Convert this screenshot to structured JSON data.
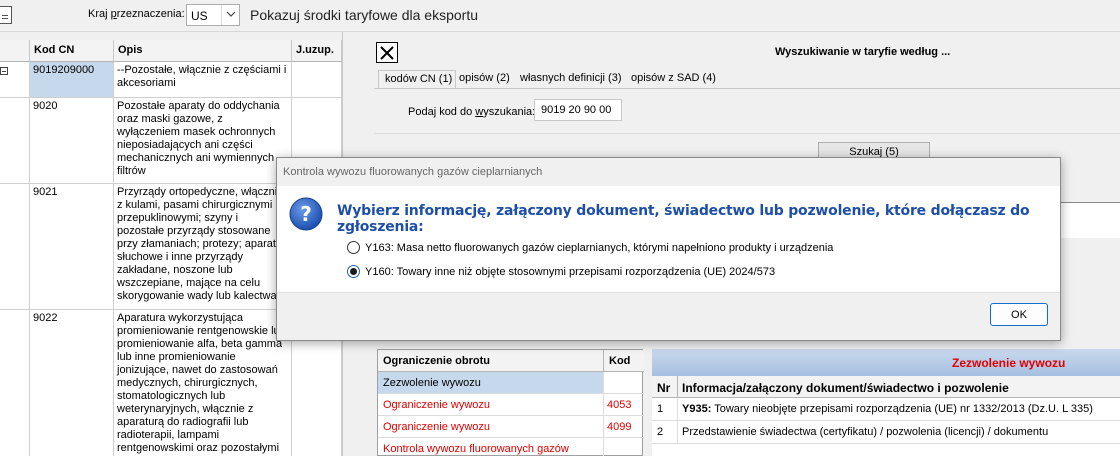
{
  "toolbar": {
    "doc_icon": "document-icon",
    "country_label_prefix": "Kraj ",
    "country_label_underlined": "p",
    "country_label_suffix": "rzeznaczenia:",
    "country_value": "US",
    "export_label": "Pokazuj środki taryfowe dla eksportu"
  },
  "left_table": {
    "headers": [
      "Kod CN",
      "Opis",
      "J.uzup."
    ],
    "rows": [
      {
        "code": "9019209000",
        "desc": "--Pozostałe, włącznie z częściami i akcesoriami",
        "unit": ""
      },
      {
        "code": "9020",
        "desc": "Pozostałe aparaty do oddychania oraz maski gazowe, z wyłączeniem masek ochronnych nieposiadających ani części mechanicznych ani wymiennych filtrów",
        "unit": ""
      },
      {
        "code": "9021",
        "desc": "Przyrządy ortopedyczne, włącznie z kulami, pasami chirurgicznymi i przepuklinowymi; szyny i pozostałe przyrządy stosowane przy złamaniach; protezy; aparaty słuchowe i inne przyrządy zakładane, noszone lub wszczepiane, mające na celu skorygowanie wady lub kalectwa",
        "unit": ""
      },
      {
        "code": "9022",
        "desc": "Aparatura wykorzystująca promieniowanie rentgenowskie lub promieniowanie alfa, beta gamma lub inne promieniowanie jonizujące, nawet do zastosowań medycznych, chirurgicznych, stomatologicznych lub weterynaryjnych, włącznie z aparaturą do radiografii lub radioterapii, lampami rentgenowskimi oraz pozostałymi generatorami promieni rentgena,",
        "unit": ""
      }
    ]
  },
  "search_panel": {
    "title": "Wyszukiwanie w taryfie według ...",
    "tabs": [
      "kodów CN (1)",
      "opisów (2)",
      "własnych definicji (3)",
      "opisów z SAD (4)"
    ],
    "code_label_prefix": "Podaj kod do ",
    "code_label_underlined": "w",
    "code_label_suffix": "yszukania:",
    "code_value": "9019 20 90 00",
    "search_button": "Szukaj (5)"
  },
  "restriction_table": {
    "headers": [
      "Ograniczenie obrotu",
      "Kod"
    ],
    "rows": [
      {
        "name": "Zezwolenie wywozu",
        "code": "",
        "red": false,
        "selected": true
      },
      {
        "name": "Ograniczenie wywozu",
        "code": "4053",
        "red": true,
        "selected": false
      },
      {
        "name": "Ograniczenie wywozu",
        "code": "4099",
        "red": true,
        "selected": false
      },
      {
        "name": "Kontrola wywozu fluorowanych gazów",
        "code": "",
        "red": true,
        "selected": false
      }
    ]
  },
  "permit_panel": {
    "title": "Zezwolenie wywozu",
    "headers": [
      "Nr",
      "Informacja/załączony dokument/świadectwo i pozwolenie"
    ],
    "rows": [
      {
        "nr": "1",
        "code": "Y935:",
        "text": " Towary nieobjęte przepisami rozporządzenia (UE) nr 1332/2013 (Dz.U. L 335)"
      },
      {
        "nr": "2",
        "code": "",
        "text": "Przedstawienie świadectwa (certyfikatu) / pozwolenia (licencji) / dokumentu"
      }
    ]
  },
  "dialog": {
    "title": "Kontrola wywozu fluorowanych gazów cieplarnianych",
    "icon": "question-icon",
    "heading": "Wybierz informację, załączony dokument, świadectwo lub pozwolenie, które dołączasz do zgłoszenia:",
    "options": [
      {
        "label": "Y163: Masa netto fluorowanych gazów cieplarnianych, którymi napełniono produkty i urządzenia",
        "checked": false
      },
      {
        "label": "Y160: Towary inne niż objęte stosownymi przepisami rozporządzenia (UE) 2024/573",
        "checked": true
      }
    ],
    "ok_label": "OK",
    "accent_color": "#1e4fa8"
  }
}
